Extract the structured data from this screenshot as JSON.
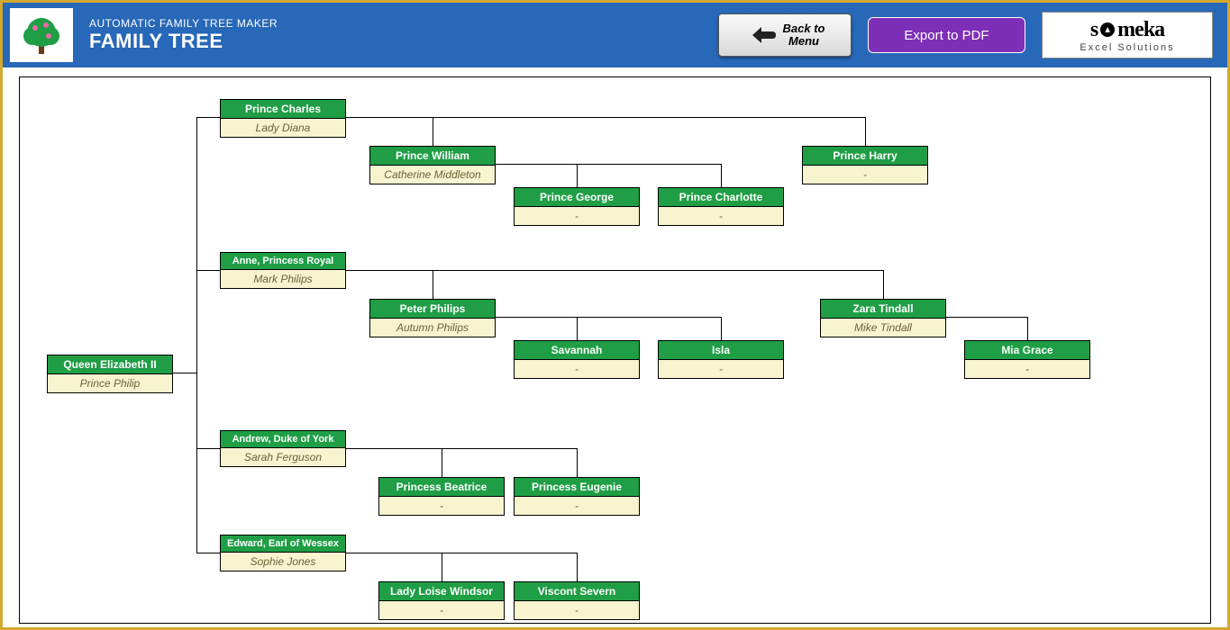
{
  "header": {
    "subtitle": "AUTOMATIC FAMILY TREE MAKER",
    "title": "FAMILY TREE",
    "back_label": "Back to Menu",
    "export_label": "Export to PDF",
    "brand_name": "someka",
    "brand_sub": "Excel Solutions"
  },
  "tree": {
    "root": {
      "primary": "Queen Elizabeth II",
      "spouse": "Prince Philip"
    },
    "children": [
      {
        "primary": "Prince Charles",
        "spouse": "Lady Diana",
        "children": [
          {
            "primary": "Prince William",
            "spouse": "Catherine Middleton",
            "children": [
              {
                "primary": "Prince George",
                "spouse": "-"
              },
              {
                "primary": "Prince Charlotte",
                "spouse": "-"
              }
            ]
          },
          {
            "primary": "Prince Harry",
            "spouse": "-"
          }
        ]
      },
      {
        "primary": "Anne, Princess Royal",
        "spouse": "Mark Philips",
        "children": [
          {
            "primary": "Peter Philips",
            "spouse": "Autumn Philips",
            "children": [
              {
                "primary": "Savannah",
                "spouse": "-"
              },
              {
                "primary": "Isla",
                "spouse": "-"
              }
            ]
          },
          {
            "primary": "Zara Tindall",
            "spouse": "Mike Tindall",
            "children": [
              {
                "primary": "Mia Grace",
                "spouse": "-"
              }
            ]
          }
        ]
      },
      {
        "primary": "Andrew, Duke of York",
        "spouse": "Sarah Ferguson",
        "children": [
          {
            "primary": "Princess Beatrice",
            "spouse": "-"
          },
          {
            "primary": "Princess Eugenie",
            "spouse": "-"
          }
        ]
      },
      {
        "primary": "Edward, Earl of Wessex",
        "spouse": "Sophie Jones",
        "children": [
          {
            "primary": "Lady Loise Windsor",
            "spouse": "-"
          },
          {
            "primary": "Viscont Severn",
            "spouse": "-"
          }
        ]
      }
    ]
  }
}
